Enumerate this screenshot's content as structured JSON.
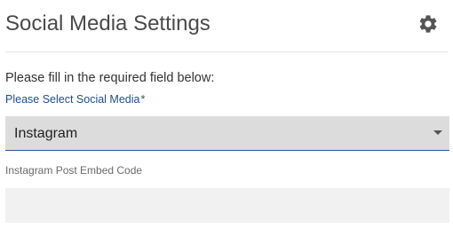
{
  "header": {
    "title": "Social Media Settings",
    "settings_icon": "gear-icon"
  },
  "form": {
    "instructions": "Please fill in the required field below:",
    "social_media_select": {
      "label": "Please Select Social Media",
      "required_marker": "*",
      "selected_value": "Instagram",
      "caret_icon": "caret-down-icon"
    },
    "embed_code": {
      "label": "Instagram Post Embed Code",
      "value": "",
      "placeholder": ""
    }
  },
  "colors": {
    "title": "#4a4a4a",
    "accent_label": "#1f4e8c",
    "select_background": "#dcdcdc",
    "select_underline": "#2a5a96",
    "input_background": "#f1f1f1",
    "divider": "#e3e3e3"
  }
}
